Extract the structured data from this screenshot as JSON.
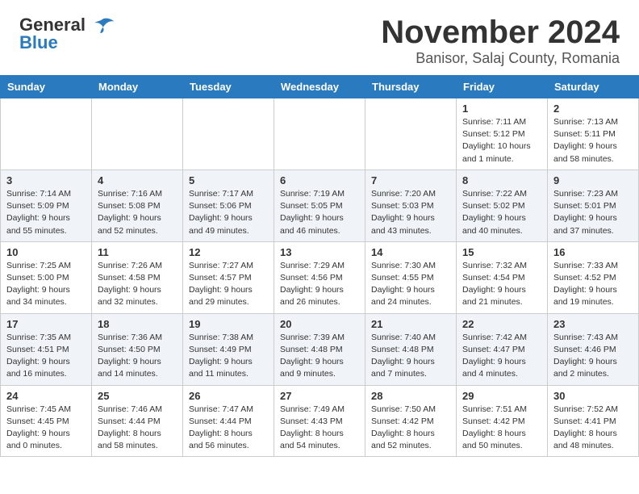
{
  "header": {
    "logo_general": "General",
    "logo_blue": "Blue",
    "month": "November 2024",
    "location": "Banisor, Salaj County, Romania"
  },
  "weekdays": [
    "Sunday",
    "Monday",
    "Tuesday",
    "Wednesday",
    "Thursday",
    "Friday",
    "Saturday"
  ],
  "weeks": [
    [
      {
        "day": "",
        "detail": ""
      },
      {
        "day": "",
        "detail": ""
      },
      {
        "day": "",
        "detail": ""
      },
      {
        "day": "",
        "detail": ""
      },
      {
        "day": "",
        "detail": ""
      },
      {
        "day": "1",
        "detail": "Sunrise: 7:11 AM\nSunset: 5:12 PM\nDaylight: 10 hours\nand 1 minute."
      },
      {
        "day": "2",
        "detail": "Sunrise: 7:13 AM\nSunset: 5:11 PM\nDaylight: 9 hours\nand 58 minutes."
      }
    ],
    [
      {
        "day": "3",
        "detail": "Sunrise: 7:14 AM\nSunset: 5:09 PM\nDaylight: 9 hours\nand 55 minutes."
      },
      {
        "day": "4",
        "detail": "Sunrise: 7:16 AM\nSunset: 5:08 PM\nDaylight: 9 hours\nand 52 minutes."
      },
      {
        "day": "5",
        "detail": "Sunrise: 7:17 AM\nSunset: 5:06 PM\nDaylight: 9 hours\nand 49 minutes."
      },
      {
        "day": "6",
        "detail": "Sunrise: 7:19 AM\nSunset: 5:05 PM\nDaylight: 9 hours\nand 46 minutes."
      },
      {
        "day": "7",
        "detail": "Sunrise: 7:20 AM\nSunset: 5:03 PM\nDaylight: 9 hours\nand 43 minutes."
      },
      {
        "day": "8",
        "detail": "Sunrise: 7:22 AM\nSunset: 5:02 PM\nDaylight: 9 hours\nand 40 minutes."
      },
      {
        "day": "9",
        "detail": "Sunrise: 7:23 AM\nSunset: 5:01 PM\nDaylight: 9 hours\nand 37 minutes."
      }
    ],
    [
      {
        "day": "10",
        "detail": "Sunrise: 7:25 AM\nSunset: 5:00 PM\nDaylight: 9 hours\nand 34 minutes."
      },
      {
        "day": "11",
        "detail": "Sunrise: 7:26 AM\nSunset: 4:58 PM\nDaylight: 9 hours\nand 32 minutes."
      },
      {
        "day": "12",
        "detail": "Sunrise: 7:27 AM\nSunset: 4:57 PM\nDaylight: 9 hours\nand 29 minutes."
      },
      {
        "day": "13",
        "detail": "Sunrise: 7:29 AM\nSunset: 4:56 PM\nDaylight: 9 hours\nand 26 minutes."
      },
      {
        "day": "14",
        "detail": "Sunrise: 7:30 AM\nSunset: 4:55 PM\nDaylight: 9 hours\nand 24 minutes."
      },
      {
        "day": "15",
        "detail": "Sunrise: 7:32 AM\nSunset: 4:54 PM\nDaylight: 9 hours\nand 21 minutes."
      },
      {
        "day": "16",
        "detail": "Sunrise: 7:33 AM\nSunset: 4:52 PM\nDaylight: 9 hours\nand 19 minutes."
      }
    ],
    [
      {
        "day": "17",
        "detail": "Sunrise: 7:35 AM\nSunset: 4:51 PM\nDaylight: 9 hours\nand 16 minutes."
      },
      {
        "day": "18",
        "detail": "Sunrise: 7:36 AM\nSunset: 4:50 PM\nDaylight: 9 hours\nand 14 minutes."
      },
      {
        "day": "19",
        "detail": "Sunrise: 7:38 AM\nSunset: 4:49 PM\nDaylight: 9 hours\nand 11 minutes."
      },
      {
        "day": "20",
        "detail": "Sunrise: 7:39 AM\nSunset: 4:48 PM\nDaylight: 9 hours\nand 9 minutes."
      },
      {
        "day": "21",
        "detail": "Sunrise: 7:40 AM\nSunset: 4:48 PM\nDaylight: 9 hours\nand 7 minutes."
      },
      {
        "day": "22",
        "detail": "Sunrise: 7:42 AM\nSunset: 4:47 PM\nDaylight: 9 hours\nand 4 minutes."
      },
      {
        "day": "23",
        "detail": "Sunrise: 7:43 AM\nSunset: 4:46 PM\nDaylight: 9 hours\nand 2 minutes."
      }
    ],
    [
      {
        "day": "24",
        "detail": "Sunrise: 7:45 AM\nSunset: 4:45 PM\nDaylight: 9 hours\nand 0 minutes."
      },
      {
        "day": "25",
        "detail": "Sunrise: 7:46 AM\nSunset: 4:44 PM\nDaylight: 8 hours\nand 58 minutes."
      },
      {
        "day": "26",
        "detail": "Sunrise: 7:47 AM\nSunset: 4:44 PM\nDaylight: 8 hours\nand 56 minutes."
      },
      {
        "day": "27",
        "detail": "Sunrise: 7:49 AM\nSunset: 4:43 PM\nDaylight: 8 hours\nand 54 minutes."
      },
      {
        "day": "28",
        "detail": "Sunrise: 7:50 AM\nSunset: 4:42 PM\nDaylight: 8 hours\nand 52 minutes."
      },
      {
        "day": "29",
        "detail": "Sunrise: 7:51 AM\nSunset: 4:42 PM\nDaylight: 8 hours\nand 50 minutes."
      },
      {
        "day": "30",
        "detail": "Sunrise: 7:52 AM\nSunset: 4:41 PM\nDaylight: 8 hours\nand 48 minutes."
      }
    ]
  ]
}
